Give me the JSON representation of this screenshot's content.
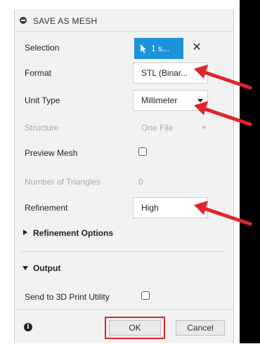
{
  "header": {
    "title": "SAVE AS MESH"
  },
  "rows": {
    "selection": {
      "label": "Selection",
      "button_label": "1 s..."
    },
    "format": {
      "label": "Format",
      "value": "STL (Binar..."
    },
    "unit_type": {
      "label": "Unit Type",
      "value": "Millimeter"
    },
    "structure": {
      "label": "Structure",
      "value": "One File"
    },
    "preview_mesh": {
      "label": "Preview Mesh"
    },
    "number_of_triangles": {
      "label": "Number of Triangles",
      "value": "0"
    },
    "refinement": {
      "label": "Refinement",
      "value": "High"
    }
  },
  "sections": {
    "refinement_options": "Refinement Options",
    "output": "Output"
  },
  "output": {
    "send_to_3d_print_label": "Send to 3D Print Utility"
  },
  "footer": {
    "ok_label": "OK",
    "cancel_label": "Cancel"
  },
  "icons": {
    "header": "minus-circle-icon",
    "selection": "cursor-arrow-icon",
    "clear": "close-icon",
    "info": "info-icon"
  },
  "colors": {
    "accent_blue": "#1c93d9",
    "annotation_red": "#e0242b"
  }
}
